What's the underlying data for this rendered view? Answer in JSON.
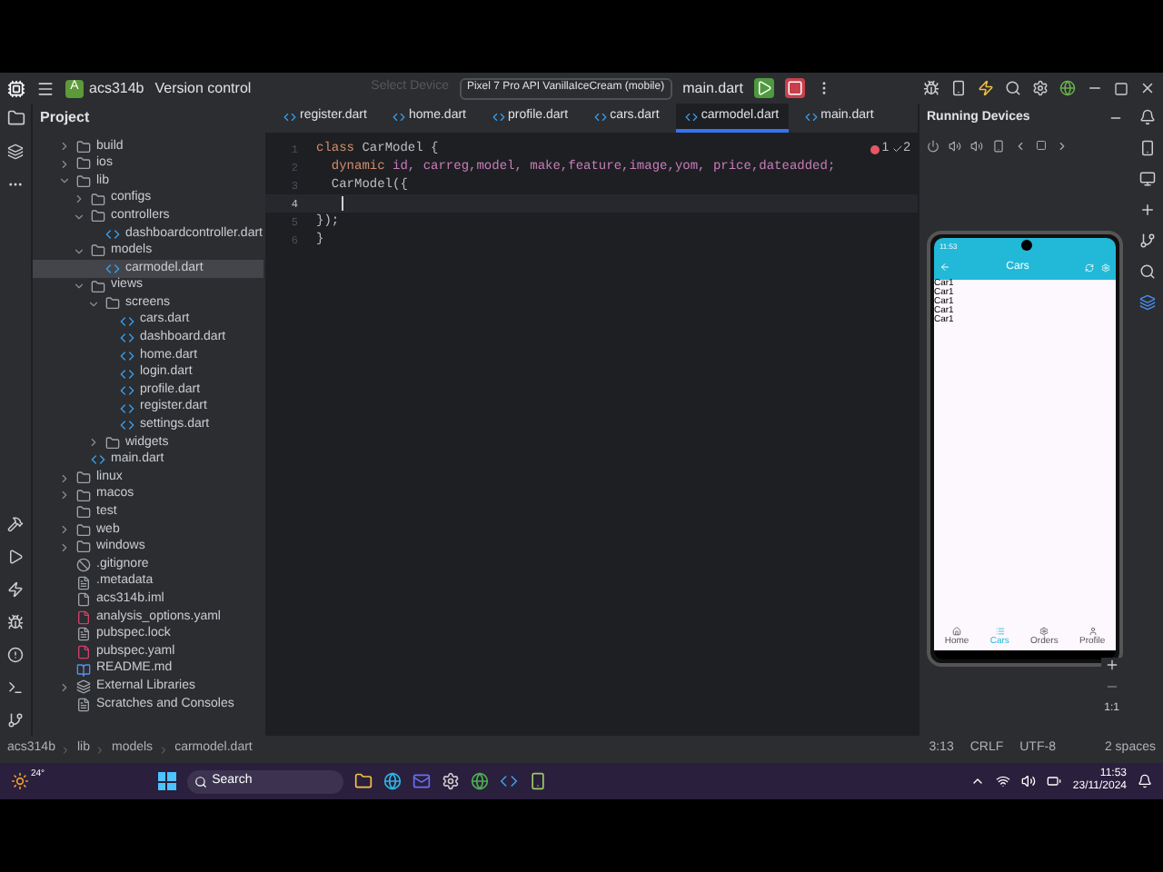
{
  "toolbar": {
    "avatar_letter": "A",
    "project": "acs314b",
    "vcs": "Version control",
    "device_placeholder": "Select Device",
    "device": "Pixel 7 Pro API VanillaIceCream (mobile)",
    "run_config": "main.dart"
  },
  "project_panel": {
    "title": "Project",
    "tree": [
      {
        "label": "build",
        "kind": "folder",
        "expanded": false,
        "selected": false
      },
      {
        "label": "ios",
        "kind": "folder",
        "expanded": false,
        "selected": false
      },
      {
        "label": "lib",
        "kind": "folder",
        "expanded": true,
        "selected": false,
        "children": [
          {
            "label": "configs",
            "kind": "folder",
            "expanded": false,
            "selected": false
          },
          {
            "label": "controllers",
            "kind": "folder",
            "expanded": true,
            "selected": false,
            "children": [
              {
                "label": "dashboardcontroller.dart",
                "kind": "dart",
                "selected": false
              }
            ]
          },
          {
            "label": "models",
            "kind": "folder",
            "expanded": true,
            "selected": false,
            "children": [
              {
                "label": "carmodel.dart",
                "kind": "dart",
                "selected": true
              }
            ]
          },
          {
            "label": "views",
            "kind": "folder",
            "expanded": true,
            "selected": false,
            "children": [
              {
                "label": "screens",
                "kind": "folder",
                "expanded": true,
                "selected": false,
                "children": [
                  {
                    "label": "cars.dart",
                    "kind": "dart",
                    "selected": false
                  },
                  {
                    "label": "dashboard.dart",
                    "kind": "dart",
                    "selected": false
                  },
                  {
                    "label": "home.dart",
                    "kind": "dart",
                    "selected": false
                  },
                  {
                    "label": "login.dart",
                    "kind": "dart",
                    "selected": false
                  },
                  {
                    "label": "profile.dart",
                    "kind": "dart",
                    "selected": false
                  },
                  {
                    "label": "register.dart",
                    "kind": "dart",
                    "selected": false
                  },
                  {
                    "label": "settings.dart",
                    "kind": "dart",
                    "selected": false
                  }
                ]
              },
              {
                "label": "widgets",
                "kind": "folder",
                "expanded": false,
                "selected": false
              }
            ]
          },
          {
            "label": "main.dart",
            "kind": "dart",
            "selected": false
          }
        ]
      },
      {
        "label": "linux",
        "kind": "folder",
        "expanded": false,
        "selected": false
      },
      {
        "label": "macos",
        "kind": "folder",
        "expanded": false,
        "selected": false
      },
      {
        "label": "test",
        "kind": "folder",
        "selected": false
      },
      {
        "label": "web",
        "kind": "folder",
        "expanded": false,
        "selected": false
      },
      {
        "label": "windows",
        "kind": "folder",
        "expanded": false,
        "selected": false
      },
      {
        "label": ".gitignore",
        "kind": "ignore",
        "selected": false
      },
      {
        "label": ".metadata",
        "kind": "text",
        "selected": false
      },
      {
        "label": "acs314b.iml",
        "kind": "module",
        "selected": false
      },
      {
        "label": "analysis_options.yaml",
        "kind": "yaml",
        "selected": false
      },
      {
        "label": "pubspec.lock",
        "kind": "text",
        "selected": false
      },
      {
        "label": "pubspec.yaml",
        "kind": "yaml",
        "selected": false
      },
      {
        "label": "README.md",
        "kind": "markdown",
        "selected": false
      },
      {
        "label": "External Libraries",
        "kind": "library",
        "expanded": false,
        "selected": false
      },
      {
        "label": "Scratches and Consoles",
        "kind": "scratch",
        "selected": false
      }
    ]
  },
  "tabs": [
    {
      "label": "register.dart",
      "selected": false
    },
    {
      "label": "home.dart",
      "selected": false
    },
    {
      "label": "profile.dart",
      "selected": false
    },
    {
      "label": "cars.dart",
      "selected": false
    },
    {
      "label": "carmodel.dart",
      "selected": true
    },
    {
      "label": "main.dart",
      "selected": false
    }
  ],
  "editor": {
    "errors": "1",
    "warnings": "2",
    "lines": [
      {
        "number": "1",
        "current": false,
        "tokens": [
          {
            "text": "class",
            "kind": "keyword"
          },
          {
            "text": " CarModel {",
            "kind": "plain"
          }
        ]
      },
      {
        "number": "2",
        "current": false,
        "tokens": [
          {
            "text": "  dynamic",
            "kind": "keyword"
          },
          {
            "text": " id, carreg,model, make,feature,image,yom, price,dateadded;",
            "kind": "field"
          }
        ]
      },
      {
        "number": "3",
        "current": false,
        "tokens": [
          {
            "text": "  CarModel({",
            "kind": "plain"
          }
        ]
      },
      {
        "number": "4",
        "current": true
      },
      {
        "number": "5",
        "current": false,
        "tokens": [
          {
            "text": "});",
            "kind": "plain"
          }
        ]
      },
      {
        "number": "6",
        "current": false,
        "tokens": [
          {
            "text": "}",
            "kind": "plain"
          }
        ]
      }
    ]
  },
  "running_devices": {
    "title": "Running Devices",
    "phone": {
      "time": "11:53",
      "app_title": "Cars",
      "items": [
        "Car1",
        "Car1",
        "Car1",
        "Car1",
        "Car1"
      ],
      "nav": [
        {
          "label": "Home",
          "selected": false
        },
        {
          "label": "Cars",
          "selected": true
        },
        {
          "label": "Orders",
          "selected": false
        },
        {
          "label": "Profile",
          "selected": false
        }
      ]
    },
    "zoom_ratio": "1:1"
  },
  "status_bar": {
    "breadcrumbs": [
      "acs314b",
      "lib",
      "models",
      "carmodel.dart"
    ],
    "position": "3:13",
    "line_ending": "CRLF",
    "encoding": "UTF-8",
    "indent": "2 spaces"
  },
  "taskbar": {
    "temperature": "24°",
    "search": "Search",
    "time": "11:53",
    "date": "23/11/2024"
  }
}
